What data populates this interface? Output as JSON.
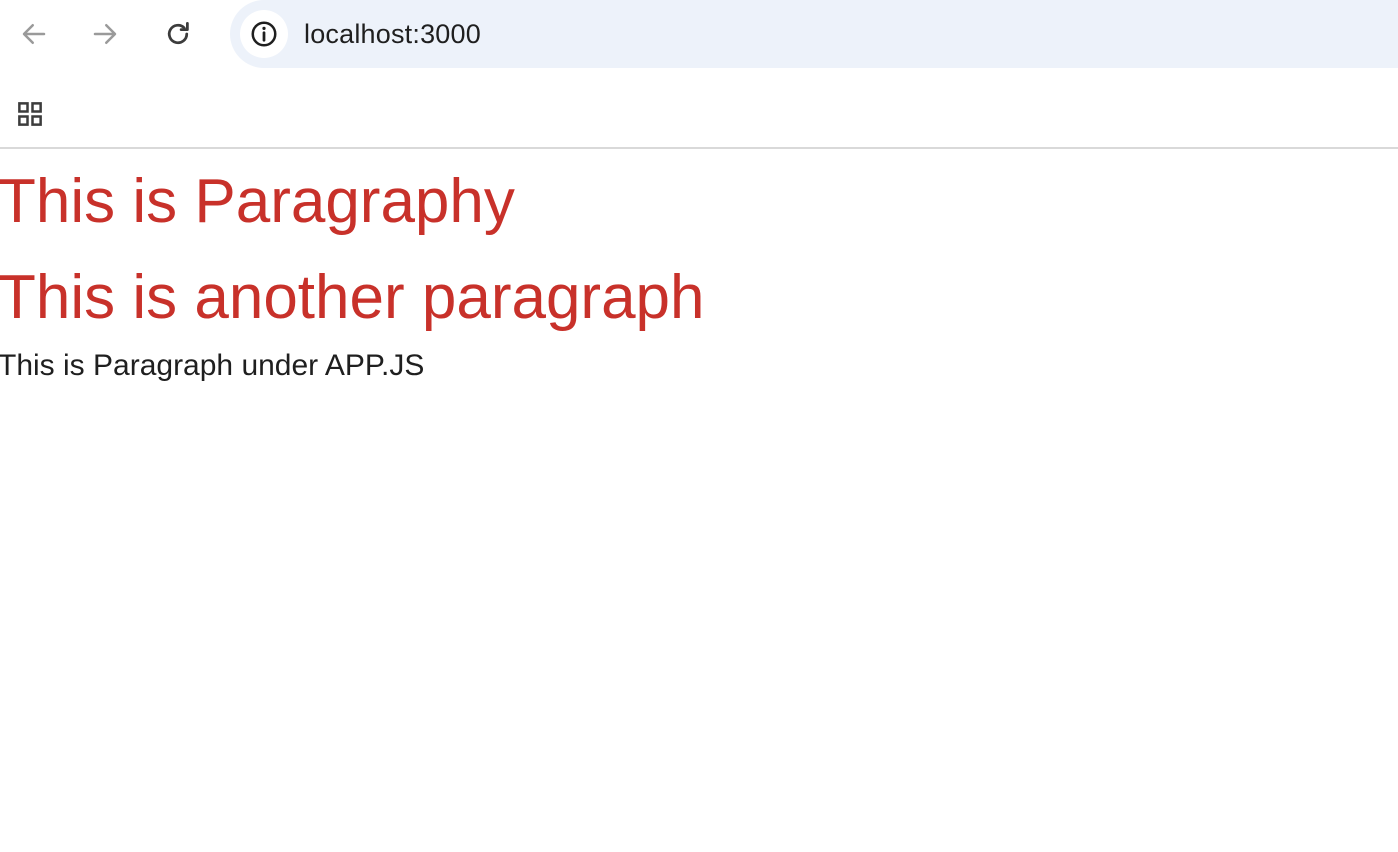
{
  "browser": {
    "address_bar": {
      "url": "localhost:3000",
      "site_info_icon": "info-circle-icon"
    },
    "nav": {
      "back_icon": "arrow-left-icon",
      "forward_icon": "arrow-right-icon",
      "reload_icon": "reload-icon"
    },
    "bookmarks_bar": {
      "apps_icon": "apps-grid-icon"
    },
    "colors": {
      "omnibox_bg": "#edf2fa",
      "icon_disabled": "#9a9a9a",
      "icon_active": "#3c3c3c"
    }
  },
  "page": {
    "heading_1": "This is Paragraphy",
    "heading_2": "This is another paragraph",
    "paragraph": "This is Paragraph under APP.JS",
    "colors": {
      "heading": "#c8312a",
      "text": "#1f1f1f"
    }
  }
}
